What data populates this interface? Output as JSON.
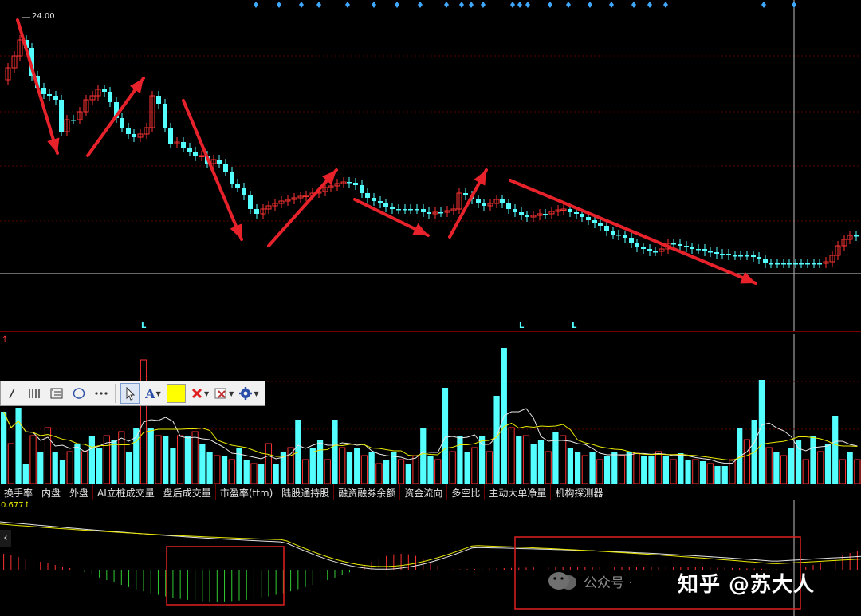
{
  "price_chart": {
    "high_label": "24.00",
    "signal_markers": [
      "L",
      "L",
      "L"
    ]
  },
  "volume_pane": {
    "label_suffix": "↑"
  },
  "macd_pane": {
    "value_label": "0.677↑",
    "left_symbol": "‹"
  },
  "tabs": [
    "换手率",
    "内盘",
    "外盘",
    "AI立桩成交量",
    "盘后成交量",
    "市盈率(ttm)",
    "陆股通持股",
    "融资融券余额",
    "资金流向",
    "多空比",
    "主动大单净量",
    "机构探测器"
  ],
  "toolbar": {
    "tools": [
      "line-tool-icon",
      "bars-tool-icon",
      "text-box-icon",
      "ellipse-icon",
      "more-icon",
      "pointer-icon",
      "font-icon",
      "color-swatch",
      "delete-icon",
      "mark-icon",
      "settings-icon"
    ],
    "font_label": "A",
    "swatch_color": "#ffff00"
  },
  "watermark": {
    "wechat": "公众号 ·",
    "zhihu": "知乎 @苏大人"
  },
  "colors": {
    "up": "#ff3232",
    "down": "#54ffff",
    "arrow": "#e8222a",
    "grid": "#5a0000",
    "ma_white": "#e6e6e6",
    "ma_yellow": "#e8e800",
    "crosshair": "#bfbfbf"
  }
}
